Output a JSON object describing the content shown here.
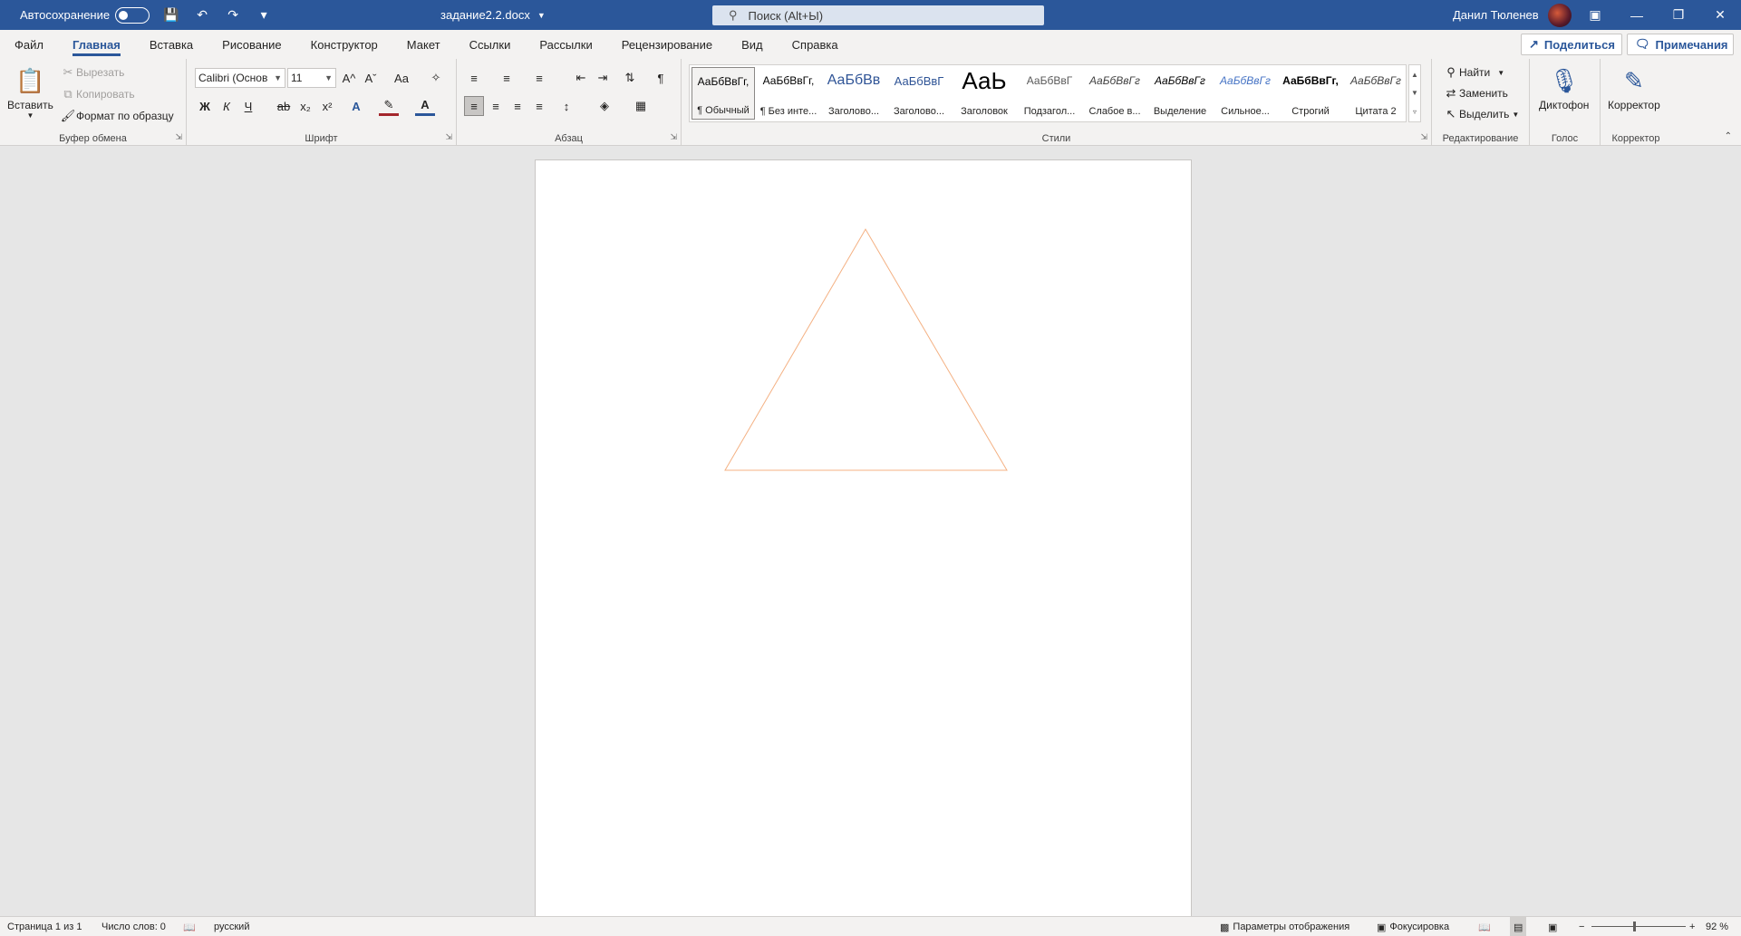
{
  "titlebar": {
    "autosave_label": "Автосохранение",
    "doc_title": "задание2.2.docx",
    "search_placeholder": "Поиск (Alt+Ы)",
    "user_name": "Данил Тюленев"
  },
  "tabs": [
    "Файл",
    "Главная",
    "Вставка",
    "Рисование",
    "Конструктор",
    "Макет",
    "Ссылки",
    "Рассылки",
    "Рецензирование",
    "Вид",
    "Справка"
  ],
  "active_tab": "Главная",
  "actions": {
    "share": "Поделиться",
    "comments": "Примечания"
  },
  "clipboard": {
    "paste": "Вставить",
    "cut": "Вырезать",
    "copy": "Копировать",
    "format_painter": "Формат по образцу",
    "label": "Буфер обмена"
  },
  "font": {
    "name": "Calibri (Основ",
    "size": "11",
    "bold": "Ж",
    "italic": "К",
    "underline": "Ч",
    "strike": "ab",
    "subscript": "x₂",
    "superscript": "x²",
    "grow": "A^",
    "shrink": "Aˇ",
    "case": "Aa",
    "label": "Шрифт"
  },
  "paragraph": {
    "label": "Абзац",
    "pilcrow": "¶"
  },
  "styles": {
    "label": "Стили",
    "items": [
      {
        "preview": "АаБбВвГг,",
        "name": "¶ Обычный"
      },
      {
        "preview": "АаБбВвГг,",
        "name": "¶ Без инте..."
      },
      {
        "preview": "АаБбВв",
        "name": "Заголово..."
      },
      {
        "preview": "АаБбВвГ",
        "name": "Заголово..."
      },
      {
        "preview": "АаЬ",
        "name": "Заголовок"
      },
      {
        "preview": "АаБбВвГ",
        "name": "Подзагол..."
      },
      {
        "preview": "АаБбВвГг",
        "name": "Слабое в..."
      },
      {
        "preview": "АаБбВвГг",
        "name": "Выделение"
      },
      {
        "preview": "АаБбВвГг",
        "name": "Сильное..."
      },
      {
        "preview": "АаБбВвГг,",
        "name": "Строгий"
      },
      {
        "preview": "АаБбВвГг",
        "name": "Цитата 2"
      }
    ]
  },
  "editing": {
    "find": "Найти",
    "replace": "Заменить",
    "select": "Выделить",
    "label": "Редактирование"
  },
  "voice": {
    "dictate": "Диктофон",
    "label": "Голос"
  },
  "editor": {
    "button": "Корректор",
    "label": "Корректор"
  },
  "document": {
    "shape": "triangle",
    "outline_color": "#f4b183"
  },
  "statusbar": {
    "page": "Страница 1 из 1",
    "words": "Число слов: 0",
    "language": "русский",
    "display_settings": "Параметры отображения",
    "focus": "Фокусировка",
    "zoom": "92 %",
    "zoom_minus": "−",
    "zoom_plus": "+"
  }
}
